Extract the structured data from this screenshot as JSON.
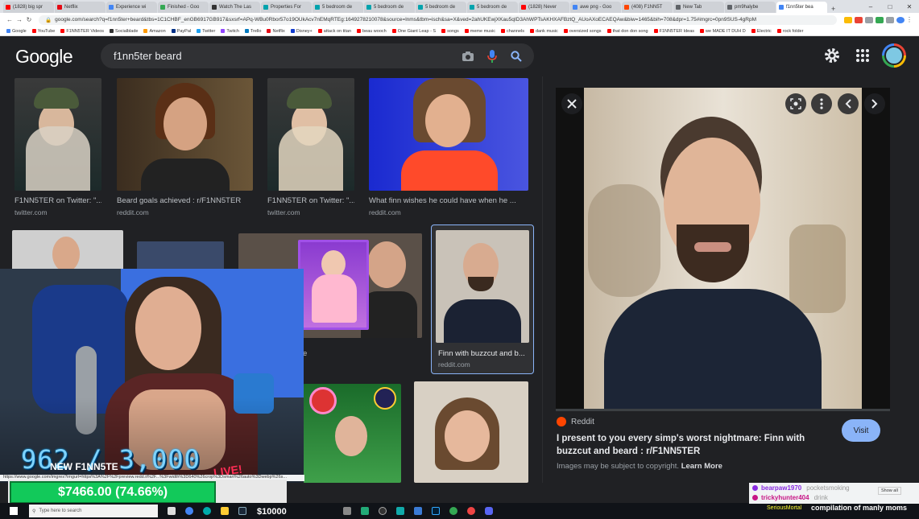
{
  "browser": {
    "tabs": [
      {
        "label": "(1828) big spr",
        "color": "#ff0000"
      },
      {
        "label": "Netflix",
        "color": "#e50914"
      },
      {
        "label": "Experience wi",
        "color": "#4285f4"
      },
      {
        "label": "Finished - Goo",
        "color": "#34a853"
      },
      {
        "label": "Watch The Las",
        "color": "#333333"
      },
      {
        "label": "Properties For",
        "color": "#00a3ad"
      },
      {
        "label": "5 bedroom de",
        "color": "#00a3ad"
      },
      {
        "label": "5 bedroom de",
        "color": "#00a3ad"
      },
      {
        "label": "5 bedroom de",
        "color": "#00a3ad"
      },
      {
        "label": "5 bedroom de",
        "color": "#00a3ad"
      },
      {
        "label": "(1828) Never",
        "color": "#ff0000"
      },
      {
        "label": "awe png - Goo",
        "color": "#4285f4"
      },
      {
        "label": "(408) F1NN5T",
        "color": "#ff4500"
      },
      {
        "label": "New Tab",
        "color": "#5f6368"
      },
      {
        "label": "pm9halybe",
        "color": "#5f6368"
      },
      {
        "label": "f1nn5ter bea",
        "color": "#4285f4",
        "active": true
      }
    ],
    "new_tab": "+",
    "url": "google.com/search?q=f1nn5ter+beard&tbs=1C1CHBF_enGB6917GB917&sxsrf=APq-WBu0Rbor57o19OUkAcv7nEMqRTEg:1649278210078&source=lnms&tbm=isch&sa=X&ved=2ahUKEwjXKau5qID3AhWPTsAKHXAFBztQ_AUoAXoECAEQAw&biw=1465&bih=708&dpr=1.75#imgrc=0pn9SUS-4gRpM",
    "bookmarks": [
      {
        "label": "Google",
        "color": "#4285f4"
      },
      {
        "label": "YouTube",
        "color": "#ff0000"
      },
      {
        "label": "F1NN5TER Videos",
        "color": "#ff0000"
      },
      {
        "label": "Socialblade",
        "color": "#333333"
      },
      {
        "label": "Amazon",
        "color": "#ff9900"
      },
      {
        "label": "PayPal",
        "color": "#003087"
      },
      {
        "label": "Twitter",
        "color": "#1da1f2"
      },
      {
        "label": "Twitch",
        "color": "#9146ff"
      },
      {
        "label": "Trello",
        "color": "#0079bf"
      },
      {
        "label": "Netflix",
        "color": "#e50914"
      },
      {
        "label": "Disney+",
        "color": "#113ccf"
      },
      {
        "label": "attack on titan",
        "color": "#ff0000"
      },
      {
        "label": "beau wooch",
        "color": "#ff0000"
      },
      {
        "label": "One Giant Leap - S",
        "color": "#ff0000"
      },
      {
        "label": "songs",
        "color": "#ff0000"
      },
      {
        "label": "meme music",
        "color": "#ff0000"
      },
      {
        "label": "channels",
        "color": "#ff0000"
      },
      {
        "label": "dank music",
        "color": "#ff0000"
      },
      {
        "label": "oversized songs",
        "color": "#ff0000"
      },
      {
        "label": "that don don song",
        "color": "#ff0000"
      },
      {
        "label": "F1NN5TER Ideas",
        "color": "#ff0000"
      },
      {
        "label": "we MADE IT DUH D",
        "color": "#ff0000"
      },
      {
        "label": "Electric",
        "color": "#ff0000"
      },
      {
        "label": "rock folder",
        "color": "#ff0000"
      }
    ]
  },
  "google": {
    "logo": "Google",
    "query": "f1nn5ter beard"
  },
  "results": [
    {
      "title": "F1NN5TER on Twitter: \"...",
      "source": "twitter.com"
    },
    {
      "title": "Beard goals achieved : r/F1NN5TER",
      "source": "reddit.com"
    },
    {
      "title": "F1NN5TER on Twitter: \"...",
      "source": "twitter.com"
    },
    {
      "title": "What finn wishes he could have when he ...",
      "source": "reddit.com"
    },
    {
      "title": "Finn with buzzcut and b...",
      "source": "reddit.com"
    }
  ],
  "panel": {
    "source": "Reddit",
    "title": "I present to you every simp's worst nightmare: Finn with buzzcut and beard : r/F1NN5TER",
    "copyright": "Images may be subject to copyright.",
    "learn_more": "Learn More",
    "visit": "Visit"
  },
  "overlay": {
    "counter": "962 / 3,000",
    "counter_sub": "NEW F1NN5TE",
    "money": "$7466.00 (74.66%)",
    "live": "LIVE!",
    "subs": "$10000",
    "status_url": "https://www.google.com/imgres?imgurl=https%3A%2F%2Fpreview.redd.it%2F...%3Fwidth%3D640%26crop%3Dsmart%26auto%3Dwebp%26s..."
  },
  "taskbar": {
    "search_placeholder": "Type here to search"
  },
  "chat": {
    "messages": [
      {
        "name": "bearpaw1970",
        "color": "#8a2be2",
        "text": "pocketsmoking"
      },
      {
        "name": "trickyhunter404",
        "color": "#c71585",
        "text": "drink"
      }
    ],
    "show_all": "Show all",
    "ticker_small": "SeriousMortal",
    "ticker": "compilation of manly moms"
  },
  "colors": {
    "accent_blue": "#8ab4f8",
    "money_green": "#12c95a",
    "reddit": "#ff4500"
  }
}
